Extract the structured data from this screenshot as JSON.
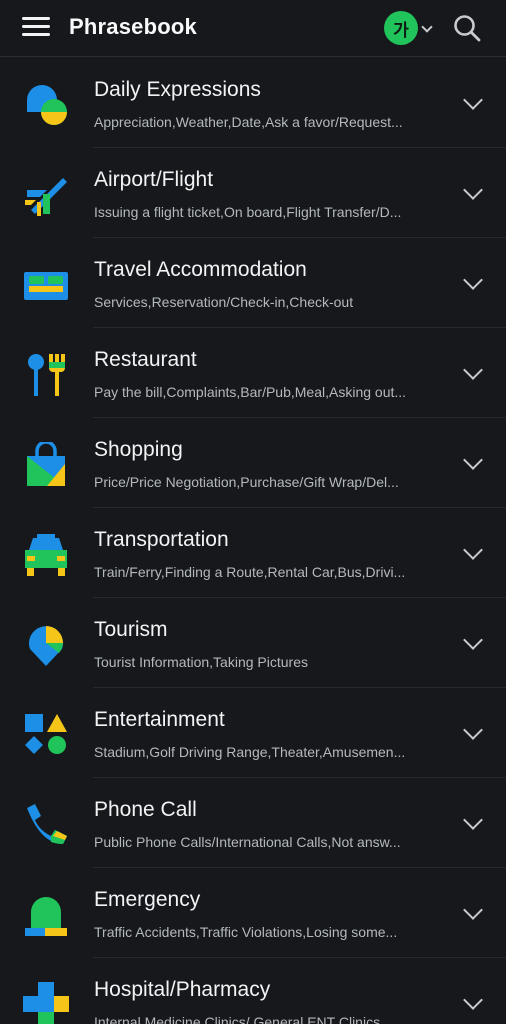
{
  "header": {
    "title": "Phrasebook",
    "language_badge": "가",
    "icons": [
      "menu-icon",
      "language-caret-icon",
      "search-icon"
    ]
  },
  "colors": {
    "background": "#16181b",
    "accent_green": "#21c35b",
    "icon_blue": "#1d8fe6",
    "icon_yellow": "#f5c518",
    "icon_green": "#21c35b"
  },
  "categories": [
    {
      "title": "Daily Expressions",
      "subtitle": "Appreciation,Weather,Date,Ask a favor/Request...",
      "icon": "daily-expressions-icon"
    },
    {
      "title": "Airport/Flight",
      "subtitle": "Issuing a flight ticket,On board,Flight Transfer/D...",
      "icon": "airplane-icon"
    },
    {
      "title": "Travel Accommodation",
      "subtitle": "Services,Reservation/Check-in,Check-out",
      "icon": "bed-icon"
    },
    {
      "title": "Restaurant",
      "subtitle": "Pay the bill,Complaints,Bar/Pub,Meal,Asking out...",
      "icon": "cutlery-icon"
    },
    {
      "title": "Shopping",
      "subtitle": "Price/Price Negotiation,Purchase/Gift Wrap/Del...",
      "icon": "shopping-bag-icon"
    },
    {
      "title": "Transportation",
      "subtitle": "Train/Ferry,Finding a Route,Rental Car,Bus,Drivi...",
      "icon": "taxi-icon"
    },
    {
      "title": "Tourism",
      "subtitle": "Tourist Information,Taking Pictures",
      "icon": "map-pin-icon"
    },
    {
      "title": "Entertainment",
      "subtitle": "Stadium,Golf Driving Range,Theater,Amusemen...",
      "icon": "shapes-icon"
    },
    {
      "title": "Phone Call",
      "subtitle": "Public Phone Calls/International Calls,Not answ...",
      "icon": "phone-icon"
    },
    {
      "title": "Emergency",
      "subtitle": "Traffic Accidents,Traffic Violations,Losing some...",
      "icon": "siren-icon"
    },
    {
      "title": "Hospital/Pharmacy",
      "subtitle": "Internal Medicine Clinics/ General ENT Clinics",
      "icon": "medical-cross-icon"
    }
  ]
}
